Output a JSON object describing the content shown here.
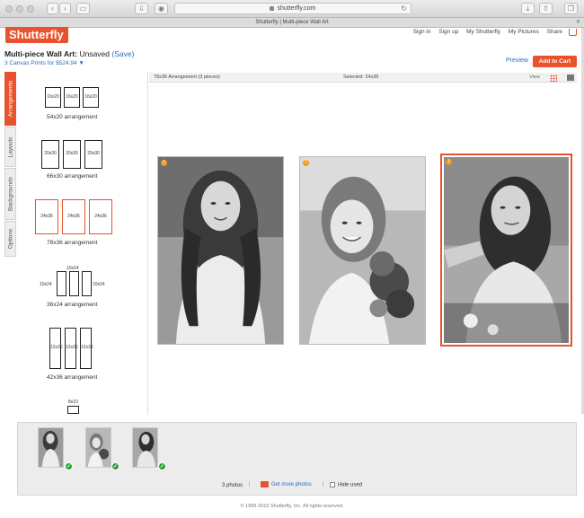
{
  "browser": {
    "url": "shutterfly.com",
    "tab_title": "Shutterfly | Multi-piece Wall Art"
  },
  "header": {
    "logo_text": "Shutterfly",
    "links": [
      "Sign in",
      "Sign up",
      "My Shutterfly",
      "My Pictures",
      "Share"
    ]
  },
  "project": {
    "title": "Multi-piece Wall Art:",
    "status": "Unsaved",
    "save_link": "(Save)",
    "subtitle": "3 Canvas Prints for $524.94",
    "preview_label": "Preview",
    "add_to_cart_label": "Add to Cart"
  },
  "side_tabs": [
    "Arrangements",
    "Layouts",
    "Backgrounds",
    "Options"
  ],
  "arrangements": [
    {
      "label": "54x20 arrangement",
      "pieces": [
        "16x20",
        "16x20",
        "16x20"
      ]
    },
    {
      "label": "66x30 arrangement",
      "pieces": [
        "20x30",
        "20x30",
        "20x30"
      ]
    },
    {
      "label": "78x36 arrangement",
      "pieces": [
        "24x36",
        "24x36",
        "24x36"
      ],
      "selected": true
    },
    {
      "label": "36x24 arrangement",
      "pieces": [
        "10x24",
        "10x24",
        "10x24"
      ]
    },
    {
      "label": "42x36 arrangement",
      "pieces": [
        "12x36",
        "12x36",
        "12x36"
      ]
    },
    {
      "label": "",
      "pieces": [
        "8x10"
      ]
    }
  ],
  "canvas": {
    "arrangement_title": "78x36 Arrangement (3 pieces)",
    "selected_info": "Selected: 24x36",
    "view_label": "View"
  },
  "tray": {
    "photo_count": "3 photos",
    "separator": "|",
    "get_more_label": "Get more photos",
    "hide_used_label": "Hide used"
  },
  "footer": {
    "copyright": "© 1999-2015 Shutterfly, Inc. All rights reserved."
  },
  "colors": {
    "accent": "#e8522c",
    "link": "#2a6ebb",
    "check": "#2e9c3a",
    "warning": "#f59b1c"
  }
}
